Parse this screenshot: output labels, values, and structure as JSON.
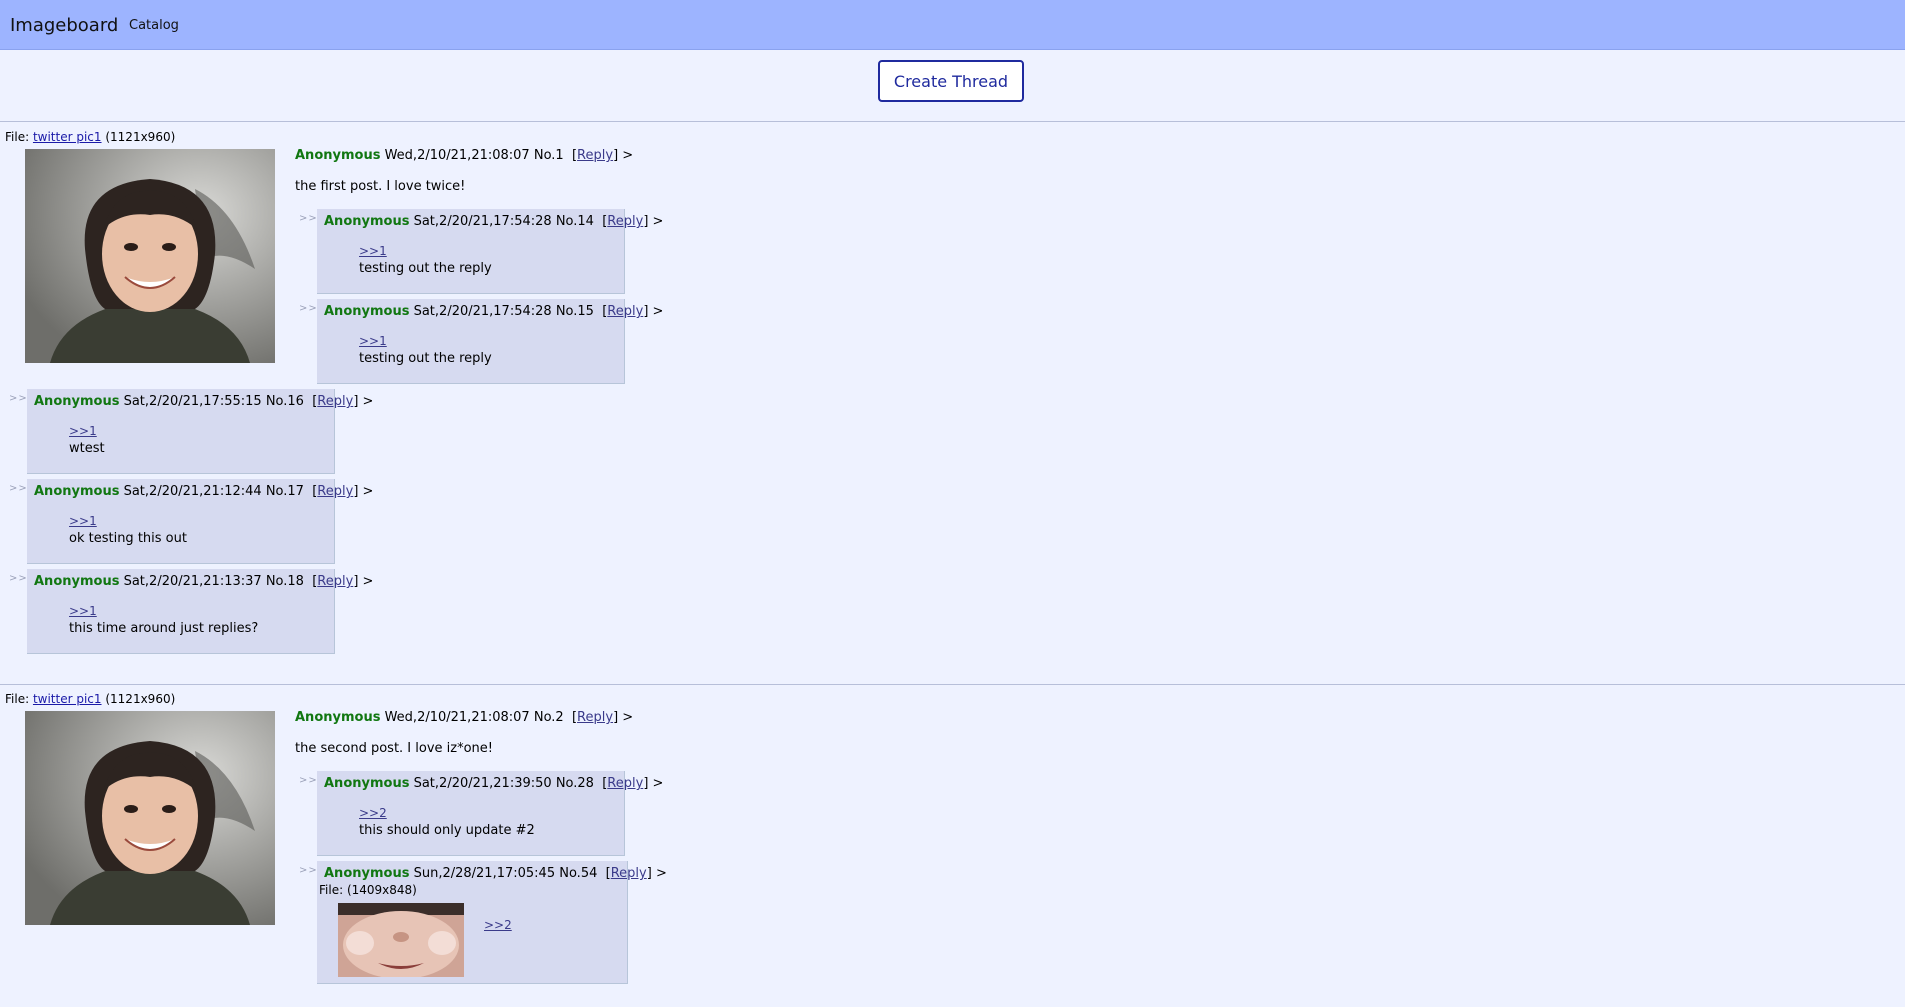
{
  "header": {
    "brand": "Imageboard",
    "catalog": "Catalog"
  },
  "create_thread": "Create Thread",
  "threads": [
    {
      "file_label": "File:",
      "file_name": "twitter pic1",
      "file_dims": "(1121x960)",
      "op": {
        "name": "Anonymous",
        "date": "Wed,2/10/21,21:08:07",
        "no": "No.1",
        "reply_open": "[",
        "reply_label": "Reply",
        "reply_close": "]",
        "caret": ">",
        "body": "the first post. I love twice!"
      },
      "replies": [
        {
          "arrows": ">>",
          "name": "Anonymous",
          "date": "Sat,2/20/21,17:54:28",
          "no": "No.14",
          "reply_label": "Reply",
          "quote": ">>1",
          "body": "testing out the reply"
        },
        {
          "arrows": ">>",
          "name": "Anonymous",
          "date": "Sat,2/20/21,17:54:28",
          "no": "No.15",
          "reply_label": "Reply",
          "quote": ">>1",
          "body": "testing out the reply"
        },
        {
          "arrows": ">>",
          "name": "Anonymous",
          "date": "Sat,2/20/21,17:55:15",
          "no": "No.16",
          "reply_label": "Reply",
          "quote": ">>1",
          "body": "wtest"
        },
        {
          "arrows": ">>",
          "name": "Anonymous",
          "date": "Sat,2/20/21,21:12:44",
          "no": "No.17",
          "reply_label": "Reply",
          "quote": ">>1",
          "body": "ok testing this out"
        },
        {
          "arrows": ">>",
          "name": "Anonymous",
          "date": "Sat,2/20/21,21:13:37",
          "no": "No.18",
          "reply_label": "Reply",
          "quote": ">>1",
          "body": "this time around just replies?"
        }
      ]
    },
    {
      "file_label": "File:",
      "file_name": "twitter pic1",
      "file_dims": "(1121x960)",
      "op": {
        "name": "Anonymous",
        "date": "Wed,2/10/21,21:08:07",
        "no": "No.2",
        "reply_open": "[",
        "reply_label": "Reply",
        "reply_close": "]",
        "caret": ">",
        "body": "the second post. I love iz*one!"
      },
      "replies": [
        {
          "arrows": ">>",
          "name": "Anonymous",
          "date": "Sat,2/20/21,21:39:50",
          "no": "No.28",
          "reply_label": "Reply",
          "quote": ">>2",
          "body": "this should only update #2"
        },
        {
          "arrows": ">>",
          "name": "Anonymous",
          "date": "Sun,2/28/21,17:05:45",
          "no": "No.54",
          "reply_label": "Reply",
          "file_line": "File: (1409x848)",
          "quote": ">>2"
        }
      ]
    }
  ],
  "colors": {
    "name": "#117711",
    "accent": "#1f2a9e",
    "topbar": "#9db4ff",
    "reply_bg": "#d6daf0"
  }
}
